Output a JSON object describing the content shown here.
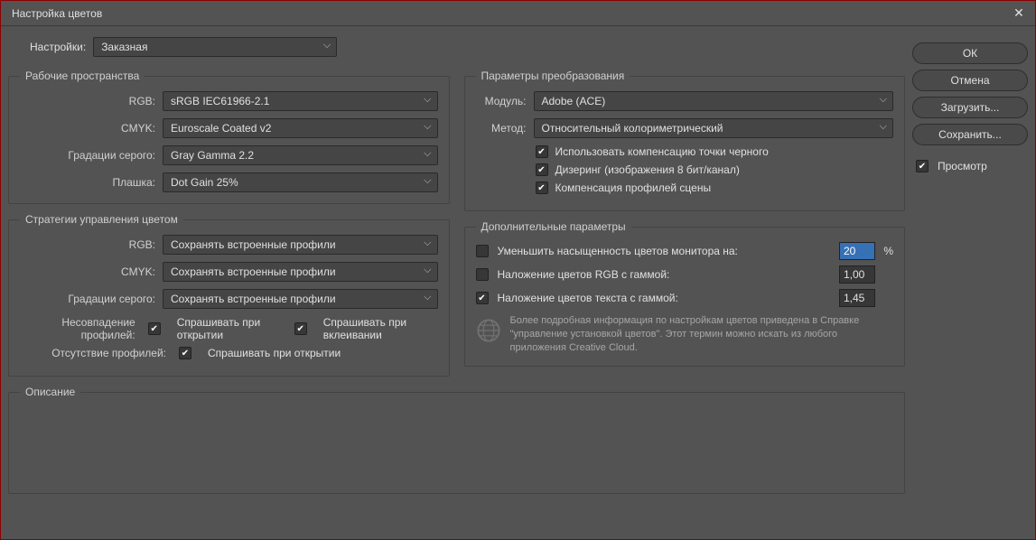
{
  "title": "Настройка цветов",
  "close": "✕",
  "settings_label": "Настройки:",
  "settings_value": "Заказная",
  "workspaces": {
    "legend": "Рабочие пространства",
    "rgb_label": "RGB:",
    "rgb_value": "sRGB IEC61966-2.1",
    "cmyk_label": "CMYK:",
    "cmyk_value": "Euroscale Coated v2",
    "gray_label": "Градации серого:",
    "gray_value": "Gray Gamma 2.2",
    "spot_label": "Плашка:",
    "spot_value": "Dot Gain 25%"
  },
  "policies": {
    "legend": "Стратегии управления цветом",
    "rgb_label": "RGB:",
    "rgb_value": "Сохранять встроенные профили",
    "cmyk_label": "CMYK:",
    "cmyk_value": "Сохранять встроенные профили",
    "gray_label": "Градации серого:",
    "gray_value": "Сохранять встроенные профили",
    "mismatch_label": "Несовпадение профилей:",
    "ask_open": "Спрашивать при открытии",
    "ask_paste": "Спрашивать при вклеивании",
    "missing_label": "Отсутствие профилей:",
    "ask_open2": "Спрашивать при открытии"
  },
  "conversion": {
    "legend": "Параметры преобразования",
    "engine_label": "Модуль:",
    "engine_value": "Adobe (ACE)",
    "intent_label": "Метод:",
    "intent_value": "Относительный колориметрический",
    "bpc": "Использовать компенсацию точки черного",
    "dither": "Дизеринг (изображения 8 бит/канал)",
    "scene": "Компенсация профилей сцены"
  },
  "advanced": {
    "legend": "Дополнительные параметры",
    "desat_label": "Уменьшить насыщенность цветов монитора на:",
    "desat_value": "20",
    "desat_suffix": "%",
    "rgb_gamma_label": "Наложение цветов RGB с гаммой:",
    "rgb_gamma_value": "1,00",
    "text_gamma_label": "Наложение цветов текста с гаммой:",
    "text_gamma_value": "1,45",
    "note": "Более подробная информация по настройкам цветов приведена в Справке \"управление установкой цветов\". Этот термин можно искать из любого приложения Creative Cloud."
  },
  "description_legend": "Описание",
  "buttons": {
    "ok": "ОК",
    "cancel": "Отмена",
    "load": "Загрузить...",
    "save": "Сохранить..."
  },
  "preview_label": "Просмотр"
}
